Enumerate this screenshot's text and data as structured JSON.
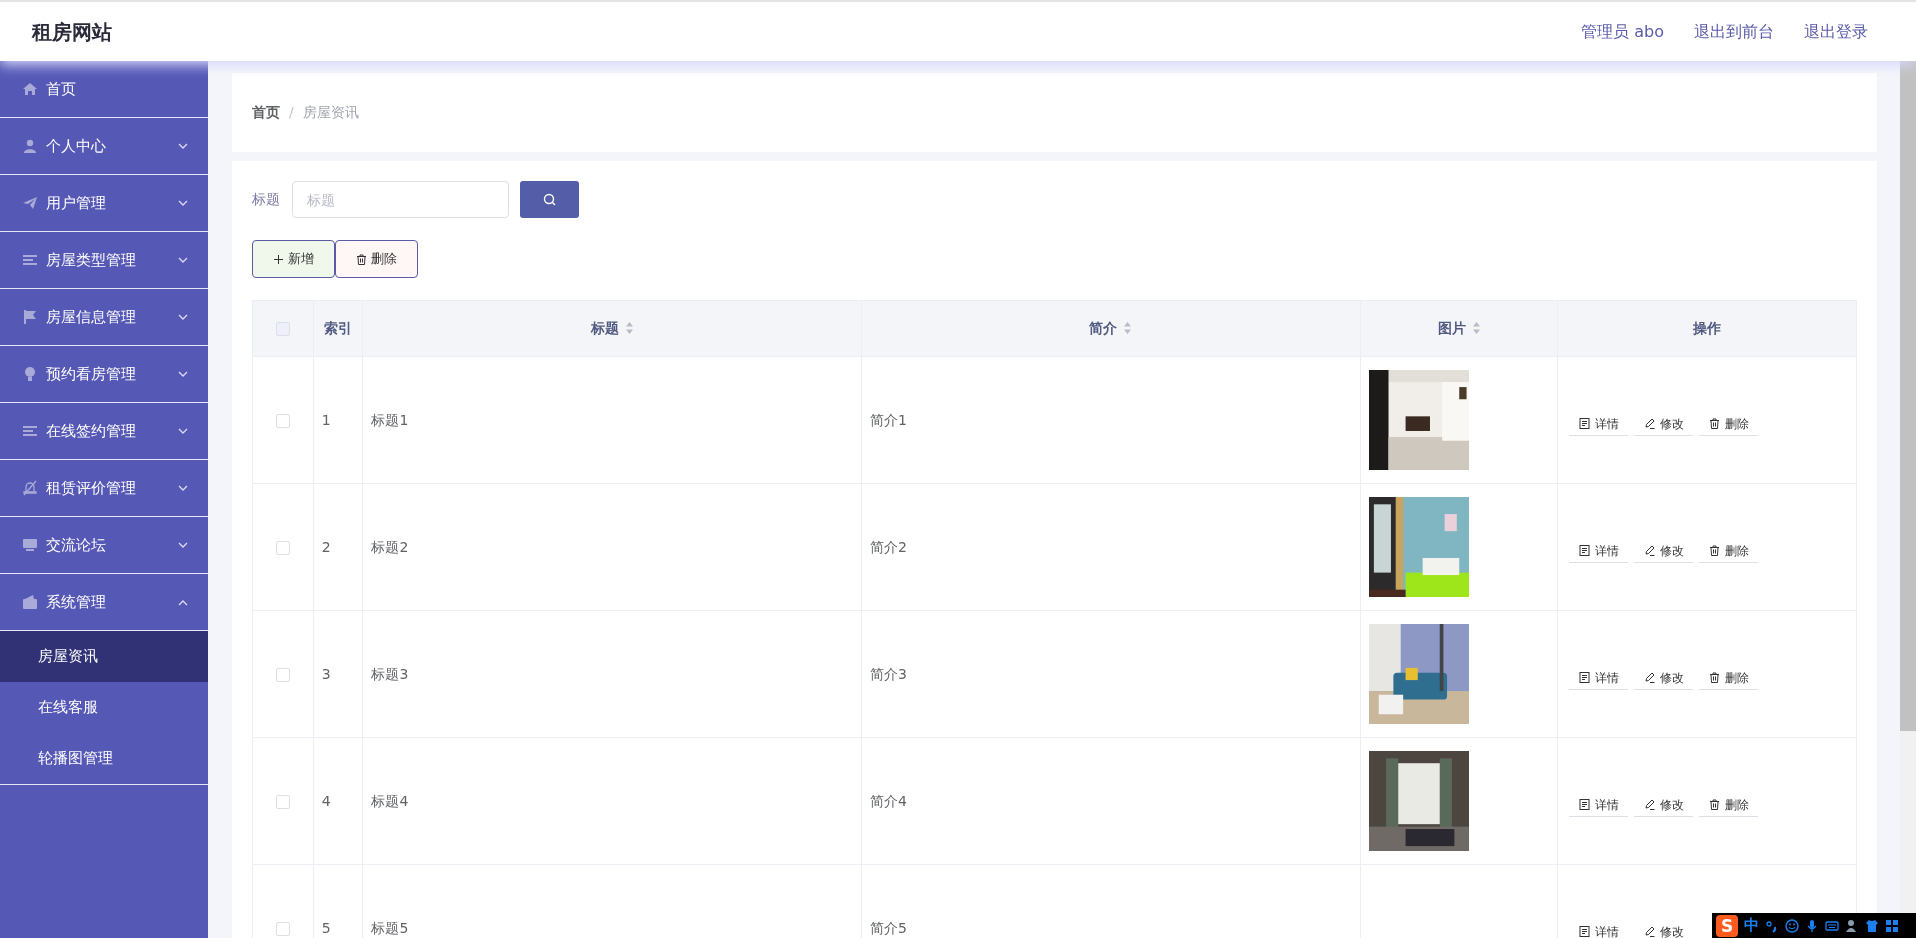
{
  "site_title": "租房网站",
  "header_links": [
    {
      "text": "管理员 abo"
    },
    {
      "text": "退出到前台"
    },
    {
      "text": "退出登录"
    }
  ],
  "sidebar": {
    "items": [
      {
        "label": "首页"
      },
      {
        "label": "个人中心",
        "expanded": false
      },
      {
        "label": "用户管理",
        "expanded": false
      },
      {
        "label": "房屋类型管理",
        "expanded": false
      },
      {
        "label": "房屋信息管理",
        "expanded": false
      },
      {
        "label": "预约看房管理",
        "expanded": false
      },
      {
        "label": "在线签约管理",
        "expanded": false
      },
      {
        "label": "租赁评价管理",
        "expanded": false
      },
      {
        "label": "交流论坛",
        "expanded": false
      },
      {
        "label": "系统管理",
        "expanded": true,
        "children": [
          {
            "label": "房屋资讯",
            "selected": true
          },
          {
            "label": "在线客服",
            "selected": false
          },
          {
            "label": "轮播图管理",
            "selected": false
          }
        ]
      }
    ]
  },
  "breadcrumb": {
    "separator": "/",
    "items": [
      "首页",
      "房屋资讯"
    ]
  },
  "search": {
    "label": "标题",
    "placeholder": "标题"
  },
  "toolbar_buttons": [
    {
      "label": "新增",
      "kind": "add"
    },
    {
      "label": "删除",
      "kind": "delete"
    }
  ],
  "table": {
    "select_all_checked": false,
    "columns": [
      {
        "label": "索引",
        "sortable": false
      },
      {
        "label": "标题",
        "sortable": true
      },
      {
        "label": "简介",
        "sortable": true
      },
      {
        "label": "图片",
        "sortable": true
      },
      {
        "label": "操作",
        "sortable": false
      }
    ],
    "rows": [
      {
        "checked": false,
        "index": "1",
        "title": "标题1",
        "intro": "简介1",
        "has_picture": true,
        "actions": [
          {
            "label": "详情",
            "kind": "detail"
          },
          {
            "label": "修改",
            "kind": "edit"
          },
          {
            "label": "删除",
            "kind": "delete"
          }
        ]
      },
      {
        "checked": false,
        "index": "2",
        "title": "标题2",
        "intro": "简介2",
        "has_picture": true,
        "actions": [
          {
            "label": "详情",
            "kind": "detail"
          },
          {
            "label": "修改",
            "kind": "edit"
          },
          {
            "label": "删除",
            "kind": "delete"
          }
        ]
      },
      {
        "checked": false,
        "index": "3",
        "title": "标题3",
        "intro": "简介3",
        "has_picture": true,
        "actions": [
          {
            "label": "详情",
            "kind": "detail"
          },
          {
            "label": "修改",
            "kind": "edit"
          },
          {
            "label": "删除",
            "kind": "delete"
          }
        ]
      },
      {
        "checked": false,
        "index": "4",
        "title": "标题4",
        "intro": "简介4",
        "has_picture": true,
        "actions": [
          {
            "label": "详情",
            "kind": "detail"
          },
          {
            "label": "修改",
            "kind": "edit"
          },
          {
            "label": "删除",
            "kind": "delete"
          }
        ]
      },
      {
        "checked": false,
        "index": "5",
        "title": "标题5",
        "intro": "简介5",
        "has_picture": false,
        "actions": [
          {
            "label": "详情",
            "kind": "detail"
          },
          {
            "label": "修改",
            "kind": "edit"
          }
        ]
      }
    ]
  },
  "ime_bar": {
    "logo": "S",
    "mode": "中"
  }
}
